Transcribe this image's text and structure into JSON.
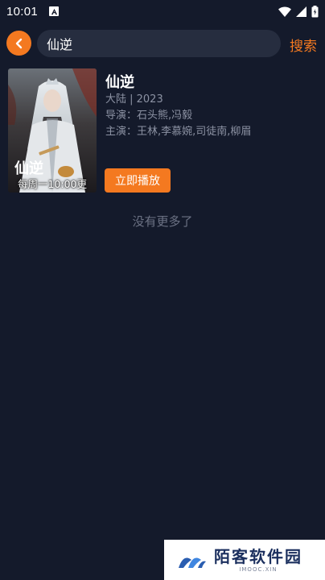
{
  "status_bar": {
    "time": "10:01",
    "icons": [
      "notification-a-icon",
      "wifi-icon",
      "signal-icon",
      "battery-icon"
    ]
  },
  "search": {
    "query": "仙逆",
    "button_label": "搜索",
    "accent_color": "#f47920"
  },
  "results": [
    {
      "title": "仙逆",
      "region_year": "大陆 | 2023",
      "director": "导演：石头熊,冯毅",
      "cast": "主演：王林,李慕婉,司徒南,柳眉",
      "poster_caption": "每周一10:00更",
      "poster_logo_text": "仙逆",
      "play_label": "立即播放"
    }
  ],
  "footer_text": "没有更多了",
  "watermark": {
    "title": "陌客软件园",
    "subtitle": "IMOOC.XIN"
  }
}
